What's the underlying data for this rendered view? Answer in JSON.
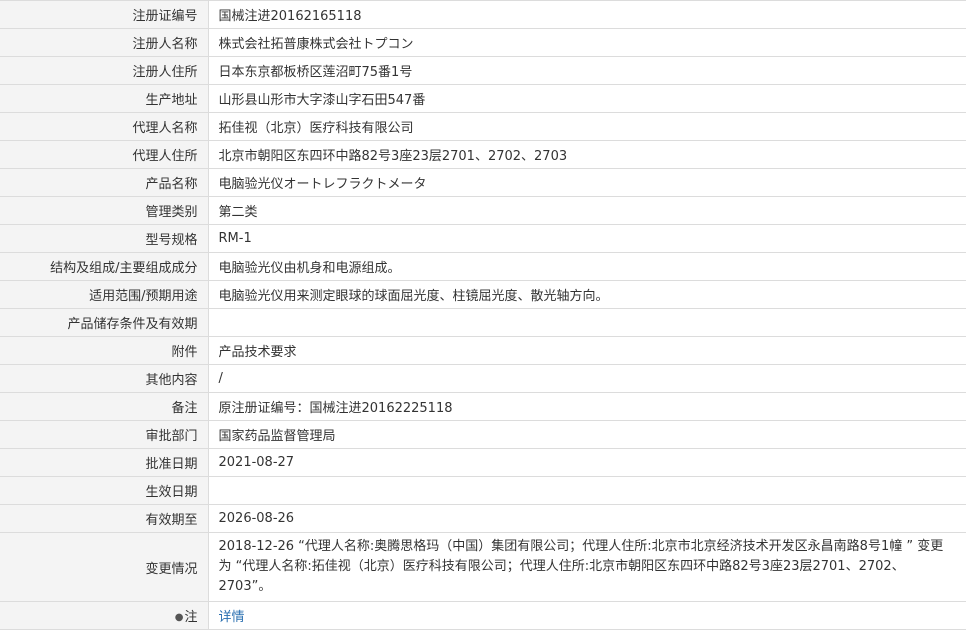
{
  "rows": [
    {
      "label": "注册证编号",
      "value": "国械注进20162165118"
    },
    {
      "label": "注册人名称",
      "value": "株式会社拓普康株式会社トプコン"
    },
    {
      "label": "注册人住所",
      "value": "日本东京都板桥区莲沼町75番1号"
    },
    {
      "label": "生产地址",
      "value": "山形县山形市大字漆山字石田547番"
    },
    {
      "label": "代理人名称",
      "value": "拓佳视（北京）医疗科技有限公司"
    },
    {
      "label": "代理人住所",
      "value": "北京市朝阳区东四环中路82号3座23层2701、2702、2703"
    },
    {
      "label": "产品名称",
      "value": "电脑验光仪オートレフラクトメータ"
    },
    {
      "label": "管理类别",
      "value": "第二类"
    },
    {
      "label": "型号规格",
      "value": "RM-1"
    },
    {
      "label": "结构及组成/主要组成成分",
      "value": "电脑验光仪由机身和电源组成。"
    },
    {
      "label": "适用范围/预期用途",
      "value": "电脑验光仪用来测定眼球的球面屈光度、柱镜屈光度、散光轴方向。"
    },
    {
      "label": "产品储存条件及有效期",
      "value": ""
    },
    {
      "label": "附件",
      "value": "产品技术要求"
    },
    {
      "label": "其他内容",
      "value": "/"
    },
    {
      "label": "备注",
      "value": "原注册证编号：国械注进20162225118"
    },
    {
      "label": "审批部门",
      "value": "国家药品监督管理局"
    },
    {
      "label": "批准日期",
      "value": "2021-08-27"
    },
    {
      "label": "生效日期",
      "value": ""
    },
    {
      "label": "有效期至",
      "value": "2026-08-26"
    },
    {
      "label": "变更情况",
      "value": "2018-12-26 “代理人名称:奥腾思格玛（中国）集团有限公司；代理人住所:北京市北京经济技术开发区永昌南路8号1幢 ” 变更为 “代理人名称:拓佳视（北京）医疗科技有限公司；代理人住所:北京市朝阳区东四环中路82号3座23层2701、2702、2703”。"
    }
  ],
  "note": {
    "label": "注",
    "icon": "lightbulb-icon",
    "link_text": "详情"
  }
}
